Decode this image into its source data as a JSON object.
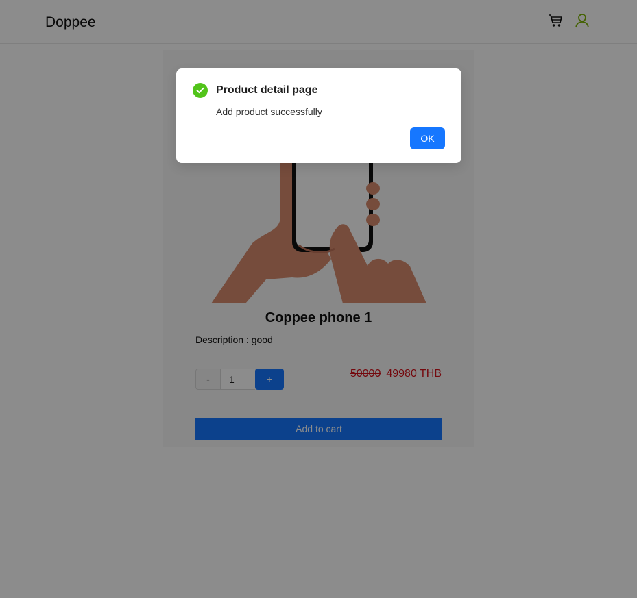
{
  "header": {
    "brand": "Doppee",
    "cart_icon": "cart-icon",
    "user_icon": "user-icon",
    "user_icon_color": "#7cb305"
  },
  "product": {
    "name": "Coppee phone 1",
    "description": "Description : good",
    "quantity": "1",
    "minus_label": "-",
    "plus_label": "+",
    "old_price": "50000",
    "price": "49980 THB",
    "add_to_cart_label": "Add to cart",
    "image_icon": "hand-holding-phone-illustration"
  },
  "modal": {
    "icon": "check-circle-icon",
    "title": "Product detail page",
    "content": "Add product successfully",
    "ok_label": "OK"
  },
  "colors": {
    "primary": "#1677ff",
    "success": "#52c41a",
    "price": "#d4121b"
  }
}
